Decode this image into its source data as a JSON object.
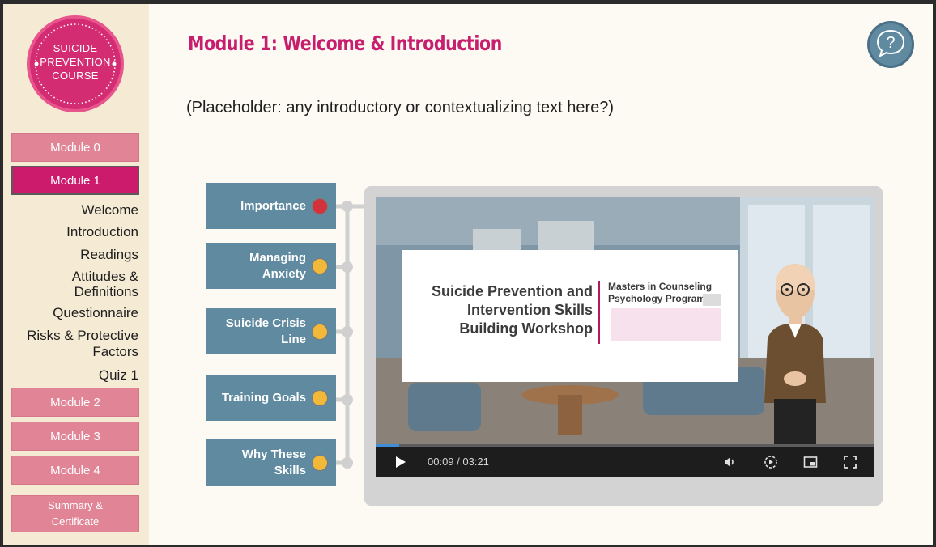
{
  "sidebar": {
    "logo_lines": [
      "SUICIDE",
      "PREVENTION",
      "COURSE"
    ],
    "modules": [
      {
        "label": "Module 0"
      },
      {
        "label": "Module 1"
      },
      {
        "label": "Module 2"
      },
      {
        "label": "Module 3"
      },
      {
        "label": "Module 4"
      }
    ],
    "summary_lines": [
      "Summary &",
      "Certificate"
    ],
    "sub_items": [
      {
        "lines": [
          "Welcome"
        ]
      },
      {
        "lines": [
          "Introduction"
        ]
      },
      {
        "lines": [
          "Readings"
        ]
      },
      {
        "lines": [
          "Attitudes &",
          "Definitions"
        ]
      },
      {
        "lines": [
          "Questionnaire"
        ]
      },
      {
        "lines": [
          "Risks & Protective",
          "Factors"
        ]
      },
      {
        "lines": [
          "Quiz 1"
        ]
      }
    ]
  },
  "main": {
    "title": "Module 1: Welcome & Introduction",
    "intro": "(Placeholder: any introductory or contextualizing text here?)",
    "help_icon": "question-bubble-icon",
    "topics": [
      {
        "lines": [
          "Importance"
        ],
        "status_color": "#d3323b"
      },
      {
        "lines": [
          "Managing",
          "Anxiety"
        ],
        "status_color": "#f2b83a"
      },
      {
        "lines": [
          "Suicide Crisis",
          "Line"
        ],
        "status_color": "#f2b83a"
      },
      {
        "lines": [
          "Training Goals"
        ],
        "status_color": "#f2b83a"
      },
      {
        "lines": [
          "Why These",
          "Skills"
        ],
        "status_color": "#f2b83a"
      }
    ]
  },
  "video": {
    "slide_title_lines": [
      "Suicide Prevention and",
      "Intervention Skills",
      "Building Workshop"
    ],
    "slide_sub_lines": [
      "Masters in Counseling",
      "Psychology Program"
    ],
    "time_display": "00:09 / 03:21",
    "progress_fraction": 0.047,
    "icons": [
      "play-icon",
      "volume-icon",
      "playback-speed-icon",
      "picture-in-picture-icon",
      "fullscreen-icon"
    ]
  },
  "colors": {
    "accent": "#c81e6e",
    "module_button": "#e08496",
    "topic_button": "#5f8aa0",
    "sidebar_bg": "#f5ead4"
  }
}
